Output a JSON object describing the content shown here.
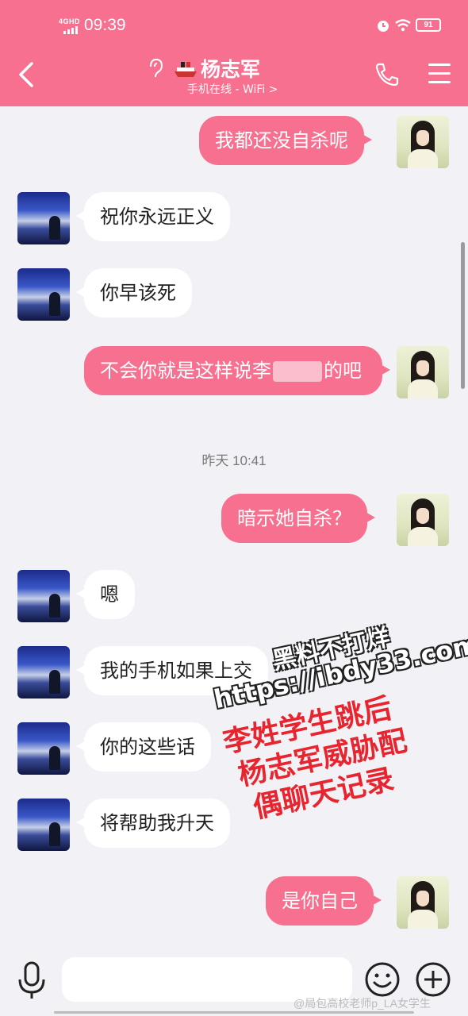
{
  "status_bar": {
    "network": "4GHD",
    "time": "09:39",
    "battery": "91"
  },
  "header": {
    "contact_name": "杨志军",
    "contact_status": "手机在线 - WiFi >"
  },
  "messages": [
    {
      "from": "self",
      "text": "我都还没自杀呢"
    },
    {
      "from": "other",
      "text": "祝你永远正义"
    },
    {
      "from": "other",
      "text": "你早该死"
    },
    {
      "from": "self",
      "text_before": "不会你就是这样说李",
      "text_after": "的吧"
    },
    {
      "from": "self",
      "text": "暗示她自杀？"
    },
    {
      "from": "other",
      "text": "嗯"
    },
    {
      "from": "other",
      "text": "我的手机如果上交"
    },
    {
      "from": "other",
      "text": "你的这些话"
    },
    {
      "from": "other",
      "text": "将帮助我升天"
    },
    {
      "from": "self",
      "text": "是你自己"
    }
  ],
  "time_divider": "昨天 10:41",
  "watermark": {
    "title": "黑料不打烊",
    "url": "https://ibdy33.com",
    "lines": [
      "李姓学生跳后",
      "杨志军威胁配",
      "偶聊天记录"
    ]
  },
  "input": {
    "placeholder": ""
  },
  "credit": "@局包高校老师p_LA女学生",
  "colors": {
    "accent": "#f7708f",
    "background": "#f2f2f6",
    "watermark_red": "#e8242e"
  }
}
